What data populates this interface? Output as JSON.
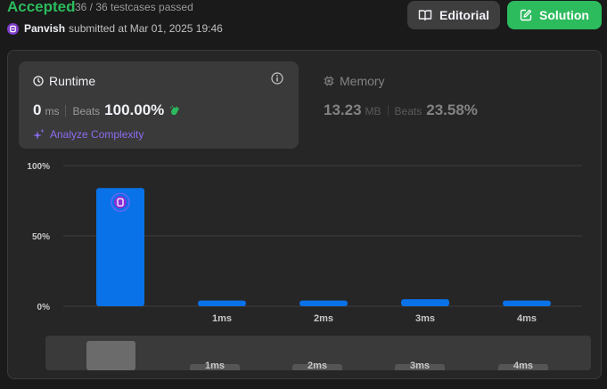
{
  "header": {
    "status": "Accepted",
    "testcases": "36 / 36 testcases passed",
    "username": "Panvish",
    "submitted_text": "submitted at Mar 01, 2025 19:46"
  },
  "buttons": {
    "editorial": "Editorial",
    "solution": "Solution"
  },
  "runtime": {
    "title": "Runtime",
    "value": "0",
    "unit": "ms",
    "beats_label": "Beats",
    "beats_value": "100.00%",
    "analyze": "Analyze Complexity"
  },
  "memory": {
    "title": "Memory",
    "value": "13.23",
    "unit": "MB",
    "beats_label": "Beats",
    "beats_value": "23.58%"
  },
  "colors": {
    "accepted": "#2cbb5d",
    "bar": "#0a72e8",
    "analyze": "#8c6cf0",
    "avatar": "#7d3cc9"
  },
  "chart_data": {
    "type": "bar",
    "categories": [
      "",
      "1ms",
      "2ms",
      "3ms",
      "4ms"
    ],
    "values": [
      84,
      4,
      4,
      5,
      4
    ],
    "y_ticks": [
      "100%",
      "50%",
      "0%"
    ],
    "ylim": [
      0,
      100
    ],
    "highlight_index": 0
  },
  "navigator": {
    "labels": [
      "1ms",
      "2ms",
      "3ms",
      "4ms"
    ]
  }
}
